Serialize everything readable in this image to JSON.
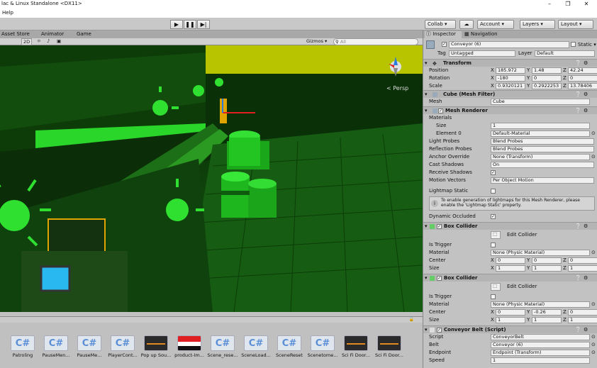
{
  "window": {
    "title": "lac & Linux Standalone <DX11>",
    "controls": [
      "–",
      "❐",
      "✕"
    ]
  },
  "menu": {
    "help": "Help"
  },
  "toolbar": {
    "play": "▶",
    "pause": "❚❚",
    "step": "▶|",
    "collab": "Collab ▾",
    "cloud": "☁",
    "account": "Account ▾",
    "layers": "Layers ▾",
    "layout": "Layout ▾"
  },
  "tabs": {
    "asset_store": "Asset Store",
    "animator": "Animator",
    "game": "Game"
  },
  "scenebar": {
    "mode_2d": "2D",
    "gizmos": "Gizmos ▾",
    "search_placeholder": "All",
    "persp": "< Persp"
  },
  "project": {
    "assets": [
      {
        "label": "Patroling",
        "icon": "C#"
      },
      {
        "label": "PauseMen...",
        "icon": "C#"
      },
      {
        "label": "PauseMe...",
        "icon": "C#"
      },
      {
        "label": "PlayerCont...",
        "icon": "C#"
      },
      {
        "label": "Pop up Sou...",
        "icon": "audio-icon"
      },
      {
        "label": "product-Im...",
        "icon": "image-icon"
      },
      {
        "label": "Scene_rese...",
        "icon": "C#"
      },
      {
        "label": "SceneLoad...",
        "icon": "C#"
      },
      {
        "label": "SceneReset",
        "icon": "C#"
      },
      {
        "label": "Scenetome...",
        "icon": "C#"
      },
      {
        "label": "Sci Fi Door...",
        "icon": "audio-icon"
      },
      {
        "label": "Sci Fi Door...",
        "icon": "audio-icon"
      }
    ]
  },
  "inspector": {
    "tab_inspector": "Inspector",
    "tab_navigation": "Navigation",
    "object_name": "Conveyor (6)",
    "static_label": "Static ▾",
    "tag_label": "Tag",
    "tag_value": "Untagged",
    "layer_label": "Layer",
    "layer_value": "Default",
    "transform": {
      "title": "Transform",
      "position_label": "Position",
      "position": [
        "185.972",
        "1.48",
        "42.24"
      ],
      "rotation_label": "Rotation",
      "rotation": [
        "-180",
        "0",
        "0"
      ],
      "scale_label": "Scale",
      "scale": [
        "0.9320121",
        "0.2922253",
        "13.78406"
      ]
    },
    "mesh_filter": {
      "title": "Cube (Mesh Filter)",
      "mesh_label": "Mesh",
      "mesh_value": "Cube"
    },
    "mesh_renderer": {
      "title": "Mesh Renderer",
      "materials_label": "Materials",
      "size_label": "Size",
      "size_value": "1",
      "element0_label": "Element 0",
      "element0_value": "Default-Material",
      "light_probes_label": "Light Probes",
      "light_probes_value": "Blend Probes",
      "reflection_probes_label": "Reflection Probes",
      "reflection_probes_value": "Blend Probes",
      "anchor_override_label": "Anchor Override",
      "anchor_override_value": "None (Transform)",
      "cast_shadows_label": "Cast Shadows",
      "cast_shadows_value": "On",
      "receive_shadows_label": "Receive Shadows",
      "motion_vectors_label": "Motion Vectors",
      "motion_vectors_value": "Per Object Motion",
      "lightmap_static_label": "Lightmap Static",
      "info_text": "To enable generation of lightmaps for this Mesh Renderer, please enable the 'Lightmap Static' property.",
      "dynamic_occluded_label": "Dynamic Occluded"
    },
    "box_collider_1": {
      "title": "Box Collider",
      "edit_collider": "Edit Collider",
      "is_trigger_label": "Is Trigger",
      "material_label": "Material",
      "material_value": "None (Physic Material)",
      "center_label": "Center",
      "center": [
        "0",
        "0",
        "0"
      ],
      "size_label": "Size",
      "size": [
        "1",
        "1",
        "1"
      ]
    },
    "box_collider_2": {
      "title": "Box Collider",
      "edit_collider": "Edit Collider",
      "is_trigger_label": "Is Trigger",
      "material_label": "Material",
      "material_value": "None (Physic Material)",
      "center_label": "Center",
      "center": [
        "0",
        "-0.26",
        "0"
      ],
      "size_label": "Size",
      "size": [
        "1",
        "1",
        "1"
      ]
    },
    "conveyor_belt": {
      "title": "Conveyor Belt (Script)",
      "script_label": "Script",
      "script_value": "ConveyorBelt",
      "belt_label": "Belt",
      "belt_value": "Conveyor (6)",
      "endpoint_label": "Endpoint",
      "endpoint_value": "Endpoint (Transform)",
      "speed_label": "Speed",
      "speed_value": "1"
    },
    "axis": {
      "x": "X",
      "y": "Y",
      "z": "Z"
    }
  },
  "colors": {
    "scene_green": "#22e02a",
    "inspector_bg": "#c2c2c2",
    "accent_blue": "#3a72c9"
  }
}
